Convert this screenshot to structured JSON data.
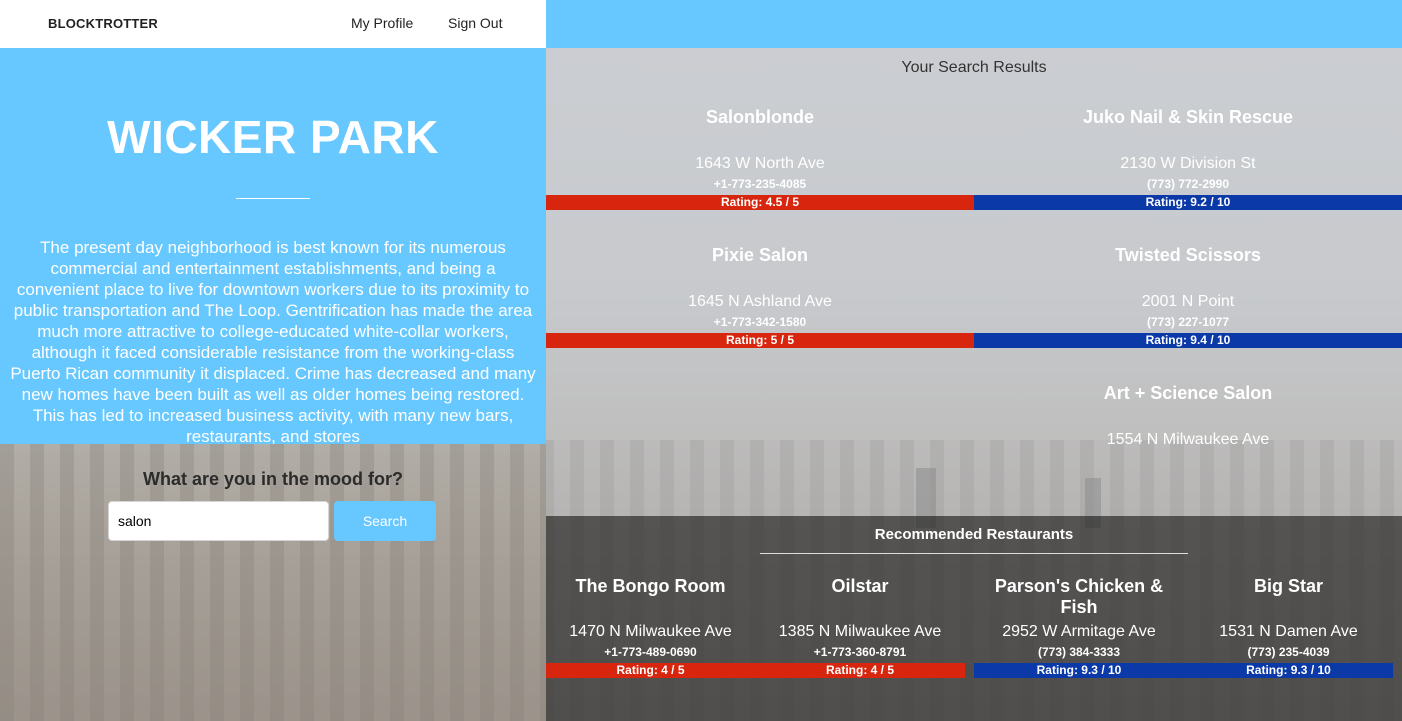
{
  "nav": {
    "brand": "BLOCKTROTTER",
    "my_profile": "My Profile",
    "sign_out": "Sign Out"
  },
  "hero": {
    "title": "WICKER PARK",
    "description": "The present day neighborhood is best known for its numerous commercial and entertainment establishments, and being a convenient place to live for downtown workers due to its proximity to public transportation and The Loop. Gentrification has made the area much more attractive to college-educated white-collar workers, although it faced considerable resistance from the working-class Puerto Rican community it displaced. Crime has decreased and many new homes have been built as well as older homes being restored. This has led to increased business activity, with many new bars, restaurants, and stores"
  },
  "search": {
    "question": "What are you in the mood for?",
    "value": "salon",
    "button": "Search"
  },
  "results": {
    "heading": "Your Search Results",
    "items": [
      {
        "name": "Salonblonde",
        "address": "1643 W North Ave",
        "phone": "+1-773-235-4085",
        "rating": "Rating: 4.5 / 5",
        "color": "#d7260d"
      },
      {
        "name": "Juko Nail & Skin Rescue",
        "address": "2130 W Division St",
        "phone": "(773) 772-2990",
        "rating": "Rating: 9.2 / 10",
        "color": "#0b39a8"
      },
      {
        "name": "Pixie Salon",
        "address": "1645 N Ashland Ave",
        "phone": "+1-773-342-1580",
        "rating": "Rating: 5 / 5",
        "color": "#d7260d"
      },
      {
        "name": "Twisted Scissors",
        "address": "2001 N Point",
        "phone": "(773) 227-1077",
        "rating": "Rating: 9.4 / 10",
        "color": "#0b39a8"
      },
      {
        "name": "Art + Science Salon",
        "address": "1554 N Milwaukee Ave"
      }
    ]
  },
  "recommended": {
    "heading": "Recommended Restaurants",
    "items": [
      {
        "name": "The Bongo Room",
        "address": "1470 N Milwaukee Ave",
        "phone": "+1-773-489-0690",
        "rating": "Rating: 4 / 5",
        "color": "#d7260d"
      },
      {
        "name": "Oilstar",
        "address": "1385 N Milwaukee Ave",
        "phone": "+1-773-360-8791",
        "rating": "Rating: 4 / 5",
        "color": "#d7260d"
      },
      {
        "name": "Parson's Chicken & Fish",
        "address": "2952 W Armitage Ave",
        "phone": "(773) 384-3333",
        "rating": "Rating: 9.3 / 10",
        "color": "#0b39a8"
      },
      {
        "name": "Big Star",
        "address": "1531 N Damen Ave",
        "phone": "(773) 235-4039",
        "rating": "Rating: 9.3 / 10",
        "color": "#0b39a8"
      }
    ]
  }
}
